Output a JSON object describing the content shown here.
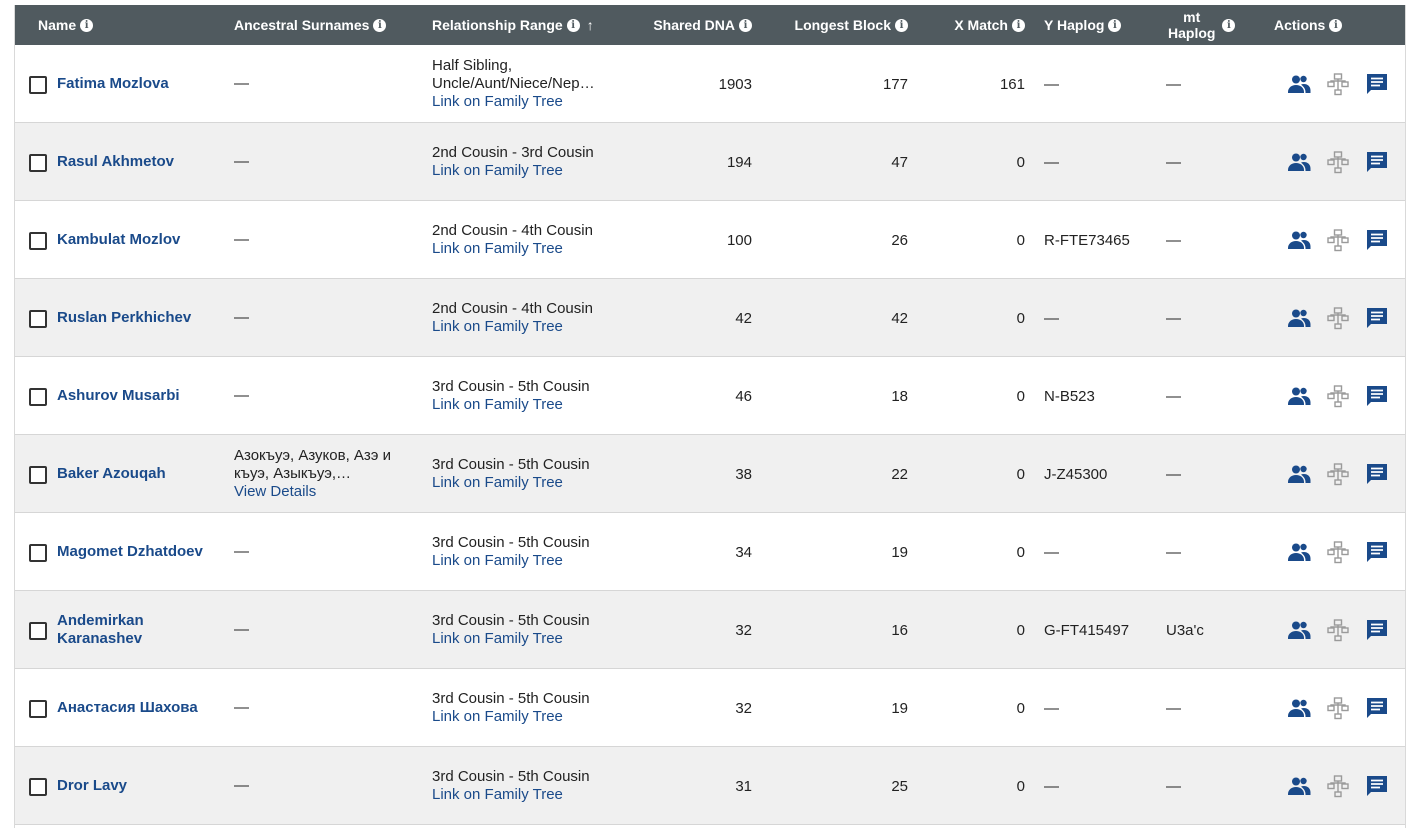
{
  "header": {
    "name": "Name",
    "surnames": "Ancestral Surnames",
    "relationship": "Relationship Range",
    "sort_arrow": "↑",
    "shared": "Shared DNA",
    "longest": "Longest Block",
    "xmatch": "X Match",
    "yhaplog": "Y Haplog",
    "mthaplog_l1": "mt",
    "mthaplog_l2": "Haplog",
    "actions": "Actions",
    "info_glyph": "i"
  },
  "icons": {
    "profile": "people-icon",
    "tree": "family-tree-icon",
    "message": "message-icon",
    "accent": "#1a4a8a",
    "tree_color": "#9a9a9a"
  },
  "rows": [
    {
      "name": "Fatima Mozlova",
      "surnames": "—",
      "surnames_link": "",
      "rel1": "Half Sibling,",
      "rel2": "Uncle/Aunt/Niece/Nep…",
      "rel_link": "Link on Family Tree",
      "shared": "1903",
      "longest": "177",
      "xmatch": "161",
      "yhaplog": "—",
      "mthaplog": "—"
    },
    {
      "name": "Rasul Akhmetov",
      "surnames": "—",
      "surnames_link": "",
      "rel1": "2nd Cousin - 3rd Cousin",
      "rel2": "",
      "rel_link": "Link on Family Tree",
      "shared": "194",
      "longest": "47",
      "xmatch": "0",
      "yhaplog": "—",
      "mthaplog": "—"
    },
    {
      "name": "Kambulat Mozlov",
      "surnames": "—",
      "surnames_link": "",
      "rel1": "2nd Cousin - 4th Cousin",
      "rel2": "",
      "rel_link": "Link on Family Tree",
      "shared": "100",
      "longest": "26",
      "xmatch": "0",
      "yhaplog": "R-FTE73465",
      "mthaplog": "—"
    },
    {
      "name": "Ruslan Perkhichev",
      "surnames": "—",
      "surnames_link": "",
      "rel1": "2nd Cousin - 4th Cousin",
      "rel2": "",
      "rel_link": "Link on Family Tree",
      "shared": "42",
      "longest": "42",
      "xmatch": "0",
      "yhaplog": "—",
      "mthaplog": "—"
    },
    {
      "name": "Ashurov Musarbi",
      "surnames": "—",
      "surnames_link": "",
      "rel1": "3rd Cousin - 5th Cousin",
      "rel2": "",
      "rel_link": "Link on Family Tree",
      "shared": "46",
      "longest": "18",
      "xmatch": "0",
      "yhaplog": "N-B523",
      "mthaplog": "—"
    },
    {
      "name": "Baker Azouqah",
      "surnames": "Азокъуэ, Азуков, Азэ и",
      "surnames2": "къуэ, Азыкъуэ,…",
      "surnames_link": "View Details",
      "rel1": "3rd Cousin - 5th Cousin",
      "rel2": "",
      "rel_link": "Link on Family Tree",
      "shared": "38",
      "longest": "22",
      "xmatch": "0",
      "yhaplog": "J-Z45300",
      "mthaplog": "—"
    },
    {
      "name": "Magomet Dzhatdoev",
      "surnames": "—",
      "surnames_link": "",
      "rel1": "3rd Cousin - 5th Cousin",
      "rel2": "",
      "rel_link": "Link on Family Tree",
      "shared": "34",
      "longest": "19",
      "xmatch": "0",
      "yhaplog": "—",
      "mthaplog": "—"
    },
    {
      "name": "Andemirkan Karanashev",
      "surnames": "—",
      "surnames_link": "",
      "rel1": "3rd Cousin - 5th Cousin",
      "rel2": "",
      "rel_link": "Link on Family Tree",
      "shared": "32",
      "longest": "16",
      "xmatch": "0",
      "yhaplog": "G-FT415497",
      "mthaplog": "U3a'c"
    },
    {
      "name": "Анастасия Шахова",
      "surnames": "—",
      "surnames_link": "",
      "rel1": "3rd Cousin - 5th Cousin",
      "rel2": "",
      "rel_link": "Link on Family Tree",
      "shared": "32",
      "longest": "19",
      "xmatch": "0",
      "yhaplog": "—",
      "mthaplog": "—"
    },
    {
      "name": "Dror Lavy",
      "surnames": "—",
      "surnames_link": "",
      "rel1": "3rd Cousin - 5th Cousin",
      "rel2": "",
      "rel_link": "Link on Family Tree",
      "shared": "31",
      "longest": "25",
      "xmatch": "0",
      "yhaplog": "—",
      "mthaplog": "—"
    }
  ]
}
